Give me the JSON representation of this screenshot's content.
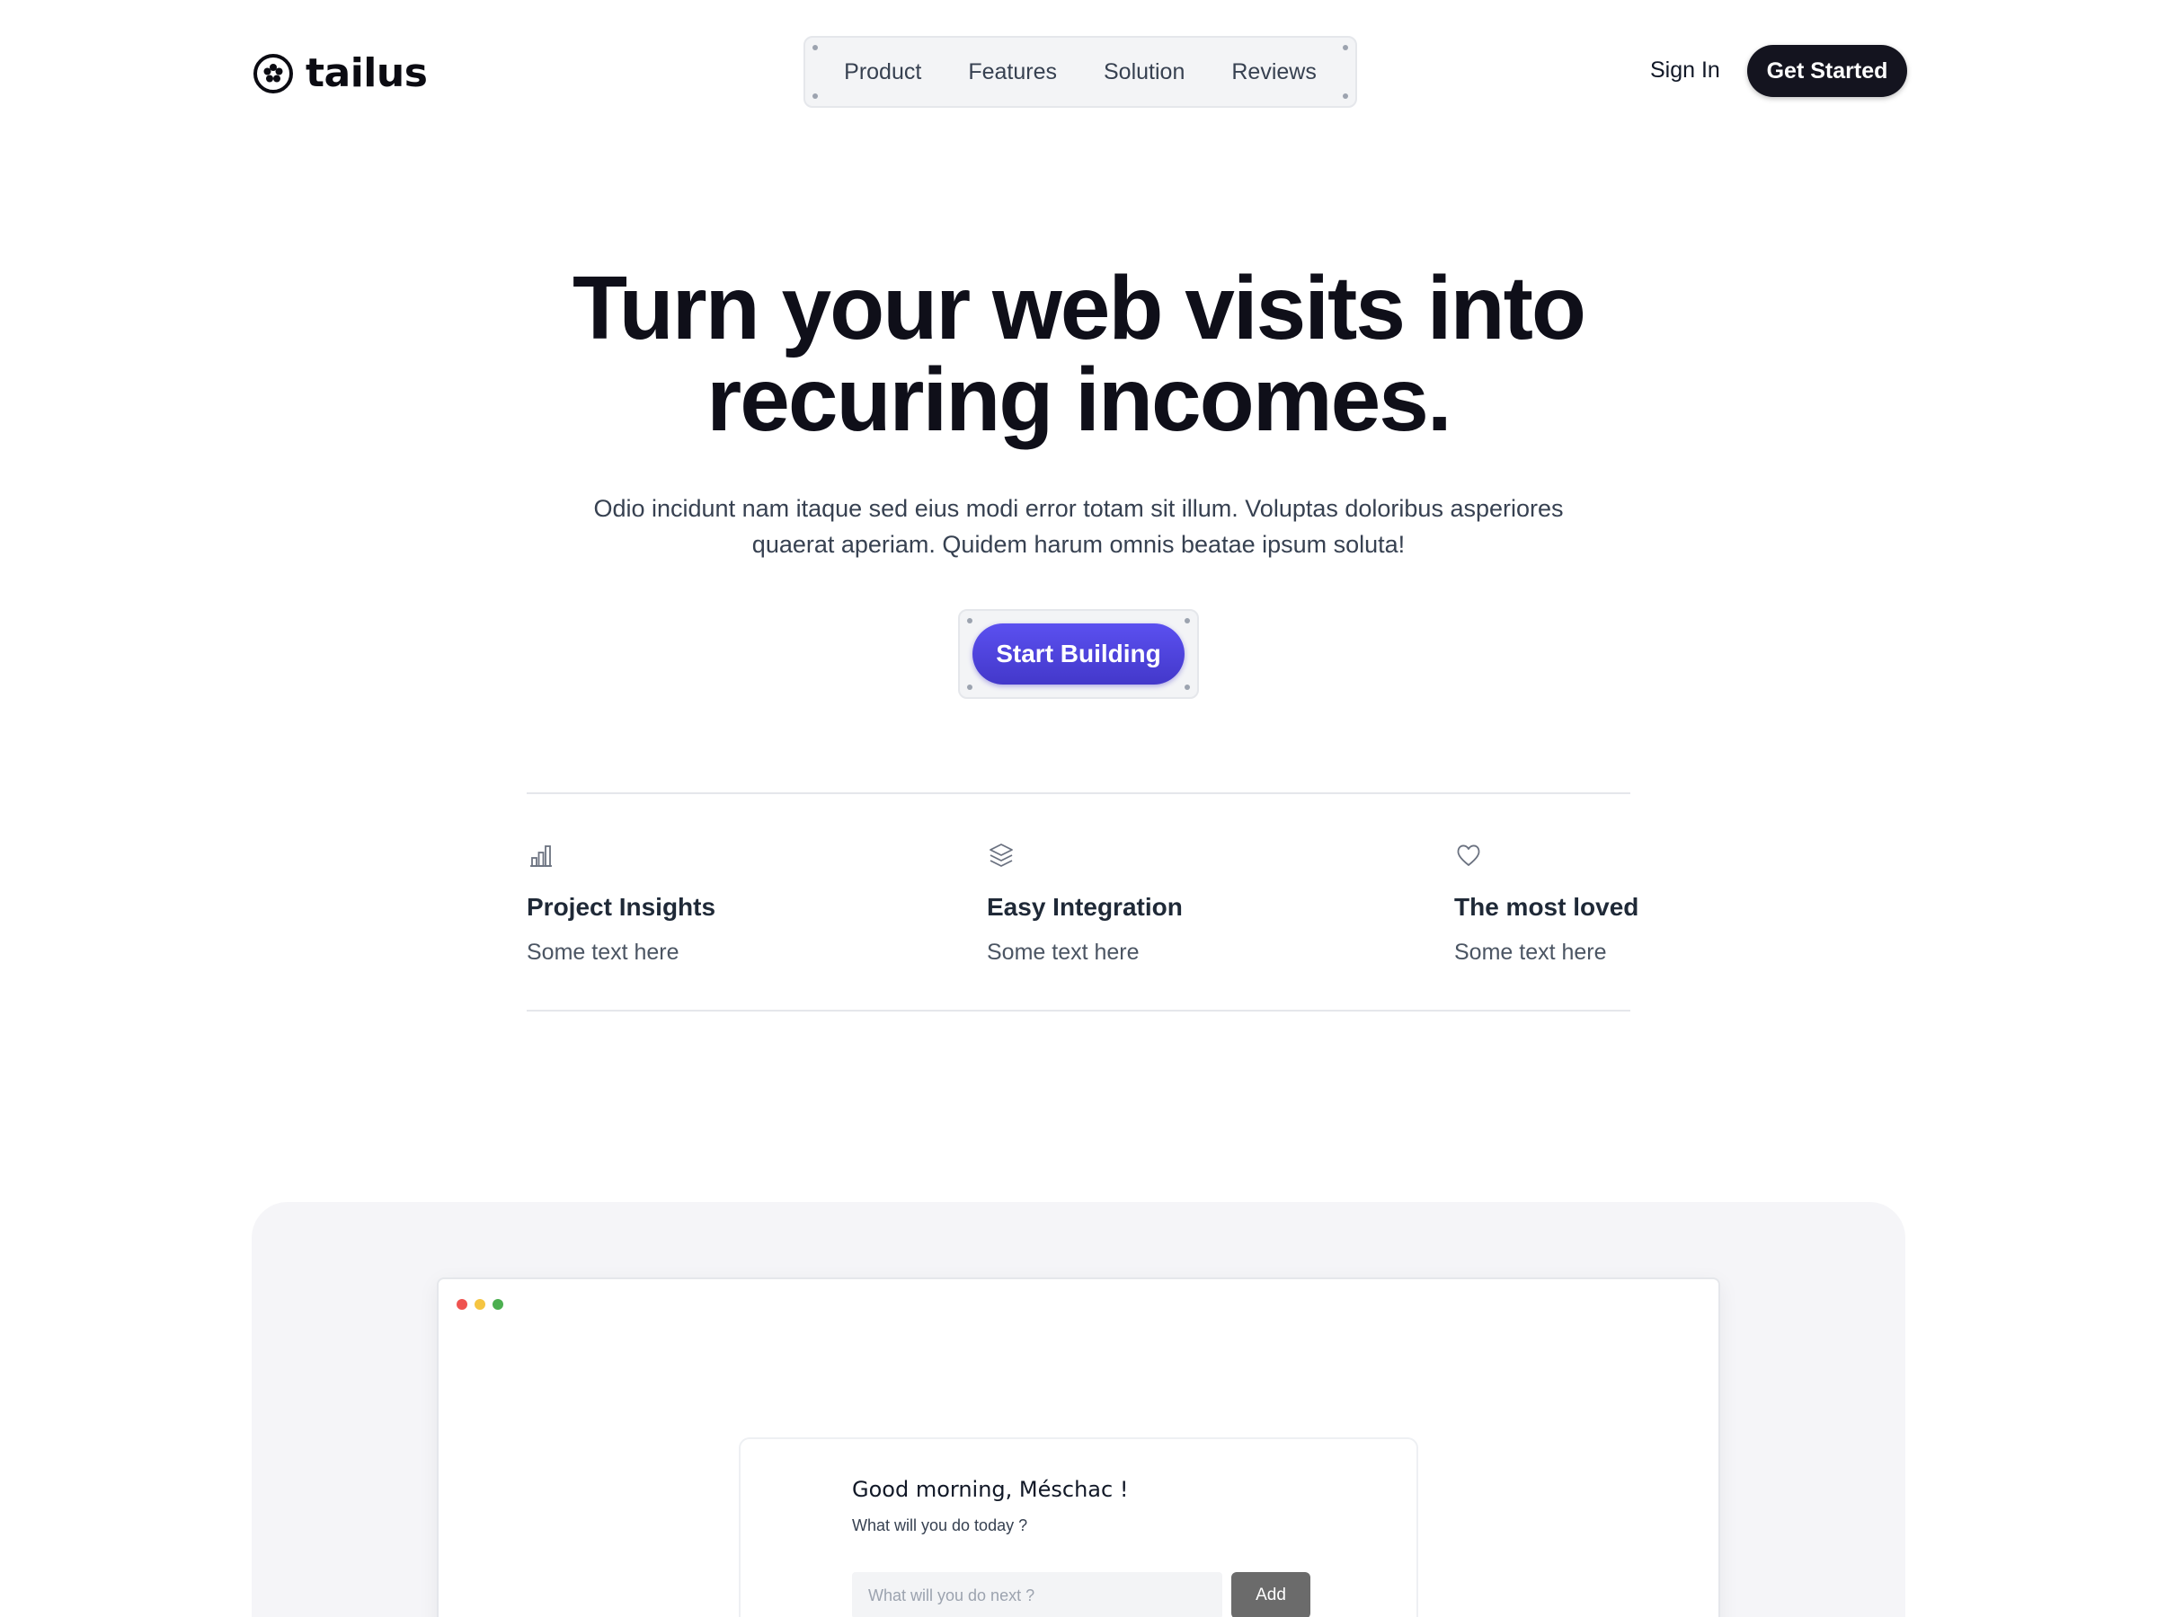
{
  "brand": {
    "name": "tailus",
    "logo_icon": "flower-circle-icon"
  },
  "nav": {
    "items": [
      "Product",
      "Features",
      "Solution",
      "Reviews"
    ]
  },
  "header": {
    "sign_in_label": "Sign In",
    "get_started_label": "Get Started"
  },
  "hero": {
    "title_line1": "Turn your web visits into",
    "title_line2": "recuring incomes.",
    "subtitle": "Odio incidunt nam itaque sed eius modi error totam sit illum. Voluptas doloribus asperiores quaerat aperiam. Quidem harum omnis beatae ipsum soluta!",
    "cta_label": "Start Building"
  },
  "features": [
    {
      "icon": "bar-chart-icon",
      "title": "Project Insights",
      "text": "Some text here"
    },
    {
      "icon": "layers-icon",
      "title": "Easy Integration",
      "text": "Some text here"
    },
    {
      "icon": "heart-icon",
      "title": "The most loved",
      "text": "Some text here"
    }
  ],
  "preview": {
    "greeting": "Good morning, Méschac !",
    "prompt": "What will you do today ?",
    "input_placeholder": "What will you do next ?",
    "add_label": "Add"
  },
  "colors": {
    "accent": "#4f46e5",
    "dark_button": "#14141f",
    "traffic_red": "#ef5350",
    "traffic_yellow": "#f5c542",
    "traffic_green": "#4caf50"
  }
}
